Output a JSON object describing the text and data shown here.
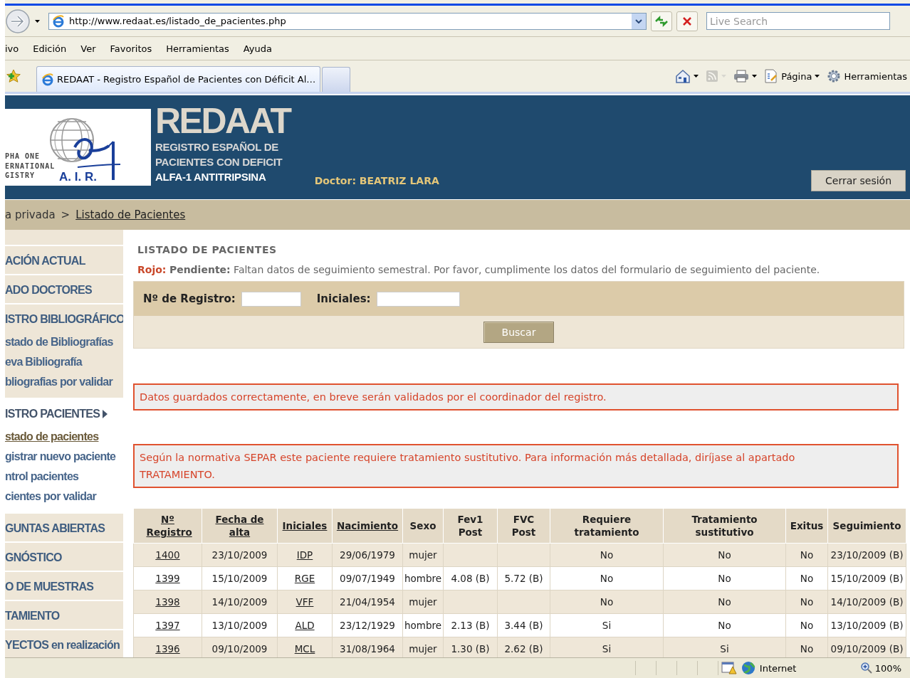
{
  "browser": {
    "address": "http://www.redaat.es/listado_de_pacientes.php",
    "search": {
      "placeholder": "Live Search"
    },
    "menu": [
      "ivo",
      "Edición",
      "Ver",
      "Favoritos",
      "Herramientas",
      "Ayuda"
    ],
    "tabs": [
      {
        "title": "REDAAT - Registro Español de Pacientes con Déficit Al…",
        "selected": true
      }
    ],
    "command_bar": [
      {
        "kind": "home",
        "disabled": false
      },
      {
        "kind": "feeds",
        "disabled": true
      },
      {
        "kind": "print",
        "disabled": false
      },
      {
        "kind": "page",
        "label": "Página",
        "disabled": false
      },
      {
        "kind": "tools",
        "label": "Herramientas",
        "disabled": false
      }
    ]
  },
  "header": {
    "logo": {
      "lines": [
        "PHA ONE",
        "ERNATIONAL",
        "GISTRY"
      ],
      "initials": "A. I. R."
    },
    "title": "REDAAT",
    "subtitle_lines": [
      "REGISTRO ESPAÑOL DE",
      "PACIENTES CON DEFICIT",
      "ALFA-1 ANTITRIPSINA"
    ],
    "doctor": "Doctor: BEATRIZ LARA",
    "logout_button": "Cerrar sesión"
  },
  "breadcrumb": {
    "parent": "a privada",
    "separator": ">",
    "current": "Listado de Pacientes"
  },
  "sidebar": [
    {
      "label": "ACIÓN ACTUAL",
      "selected": false
    },
    {
      "label": "ADO DOCTORES",
      "selected": false
    },
    {
      "label": "ISTRO BIBLIOGRÁFICO",
      "selected": false,
      "children": [
        {
          "label": "stado de Bibliografías",
          "selected": false
        },
        {
          "label": "eva Bibliografía",
          "selected": false
        },
        {
          "label": "bliografias por validar",
          "selected": false
        }
      ]
    },
    {
      "label": "ISTRO PACIENTES",
      "selected": true,
      "children": [
        {
          "label": "stado de pacientes",
          "selected": true
        },
        {
          "label": "gistrar nuevo paciente",
          "selected": false
        },
        {
          "label": "ntrol pacientes",
          "selected": false
        },
        {
          "label": "cientes por validar",
          "selected": false
        }
      ]
    },
    {
      "label": "GUNTAS ABIERTAS",
      "selected": false
    },
    {
      "label": "GNÓSTICO",
      "selected": false
    },
    {
      "label": "O DE MUESTRAS",
      "selected": false
    },
    {
      "label": "TAMIENTO",
      "selected": false
    },
    {
      "label": "YECTOS en realización",
      "selected": false
    }
  ],
  "main": {
    "title": "LISTADO DE PACIENTES",
    "legend": "**Rojo:** **Pendiente:** Faltan datos de seguimiento semestral. Por favor, cumplimente los datos del formulario de seguimiento del paciente.",
    "search_form": {
      "fields": [
        {
          "label": "Nº de Registro:"
        },
        {
          "label": "Iniciales:"
        }
      ],
      "button": "Buscar"
    },
    "messages": [
      "Datos guardados correctamente, en breve serán validados por el coordinador del registro.",
      "Según la normativa SEPAR este paciente requiere tratamiento sustitutivo. Para información más detallada, diríjase al apartado TRATAMIENTO."
    ],
    "table": {
      "columns": [
        {
          "label": "Nº Registro",
          "sortable": true,
          "kind": "link"
        },
        {
          "label": "Fecha de alta",
          "sortable": true,
          "kind": "text"
        },
        {
          "label": "Iniciales",
          "sortable": true,
          "kind": "link"
        },
        {
          "label": "Nacimiento",
          "sortable": true,
          "kind": "text"
        },
        {
          "label": "Sexo",
          "sortable": false,
          "kind": "text"
        },
        {
          "label": "Fev1 Post",
          "sortable": false,
          "kind": "text"
        },
        {
          "label": "FVC Post",
          "sortable": false,
          "kind": "text"
        },
        {
          "label": "Requiere tratamiento",
          "sortable": false,
          "kind": "text"
        },
        {
          "label": "Tratamiento sustitutivo",
          "sortable": false,
          "kind": "text"
        },
        {
          "label": "Exitus",
          "sortable": false,
          "kind": "text"
        },
        {
          "label": "Seguimiento",
          "sortable": false,
          "kind": "text"
        }
      ],
      "rows": [
        [
          "1400",
          "23/10/2009",
          "IDP",
          "29/06/1979",
          "mujer",
          "",
          "",
          "No",
          "No",
          "No",
          "23/10/2009 (B)"
        ],
        [
          "1399",
          "15/10/2009",
          "RGE",
          "09/07/1949",
          "hombre",
          "4.08 (B)",
          "5.72 (B)",
          "No",
          "No",
          "No",
          "15/10/2009 (B)"
        ],
        [
          "1398",
          "14/10/2009",
          "VFF",
          "21/04/1954",
          "mujer",
          "",
          "",
          "No",
          "No",
          "No",
          "14/10/2009 (B)"
        ],
        [
          "1397",
          "13/10/2009",
          "ALD",
          "23/12/1929",
          "hombre",
          "2.13 (B)",
          "3.44 (B)",
          "Si",
          "No",
          "No",
          "13/10/2009 (B)"
        ],
        [
          "1396",
          "09/10/2009",
          "MCL",
          "31/08/1964",
          "mujer",
          "1.30 (B)",
          "2.62 (B)",
          "Si",
          "Si",
          "No",
          "09/10/2009 (B)"
        ]
      ]
    }
  },
  "status_bar": {
    "zone": "Internet",
    "zoom": "100%"
  }
}
